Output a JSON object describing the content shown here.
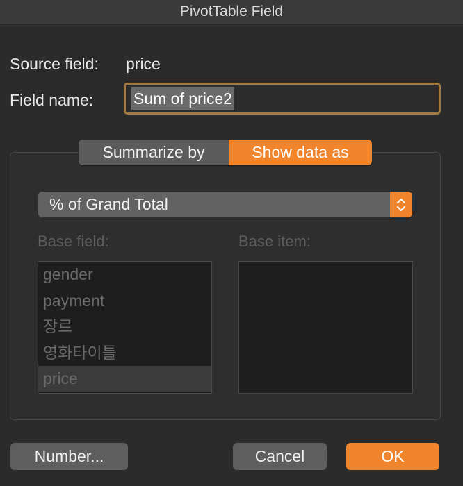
{
  "window": {
    "title": "PivotTable Field"
  },
  "source": {
    "label": "Source field:",
    "value": "price"
  },
  "field_name": {
    "label": "Field name:",
    "value": "Sum of price2"
  },
  "tabs": [
    {
      "label": "Summarize by",
      "active": false
    },
    {
      "label": "Show data as",
      "active": true
    }
  ],
  "show_as": {
    "selected": "% of Grand Total"
  },
  "base_field": {
    "label": "Base field:",
    "items": [
      "gender",
      "payment",
      "장르",
      "영화타이틀",
      "price"
    ],
    "selected": "price"
  },
  "base_item": {
    "label": "Base item:",
    "items": []
  },
  "buttons": {
    "number": "Number...",
    "cancel": "Cancel",
    "ok": "OK"
  },
  "colors": {
    "accent": "#f0852d",
    "background": "#2b2b2b",
    "focus_ring": "#a07a3f"
  },
  "icons": {
    "select_arrow": "up-down-chevron-icon"
  }
}
